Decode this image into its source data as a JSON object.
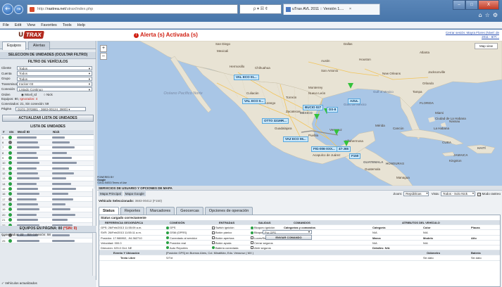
{
  "browser": {
    "url_prefix": "http://",
    "url_host": "rastrea.net",
    "url_rest": "/utrax/index.php",
    "addr_tools": "ρ ▾ ☒ ¢",
    "tab_title": "uTrax AVL 2011 :: Versión 1....",
    "tab_close": "×",
    "menu": [
      "File",
      "Edit",
      "View",
      "Favorites",
      "Tools",
      "Help"
    ],
    "back": "←",
    "forward": "→",
    "min": "–",
    "max": "□",
    "close": "X",
    "tool_icons": [
      "⌂",
      "☆",
      "⚙"
    ]
  },
  "header": {
    "logo_u": "U",
    "logo_trax": "TRAX",
    "alert_icon": "!",
    "alert_text": "Alerta (s) Activada (s)",
    "session_link": "Cerrar sesión: Mayra Flores (Nivel: de",
    "session_sub": "2011 - 8/7/..."
  },
  "left": {
    "tabs": [
      "Equipos",
      "Alertas"
    ],
    "selection_header": "SELECCION DE UNIDADES (OCULTAR FILTRO)",
    "filter_header": "FILTRO DE VEHÍCULOS",
    "filters": [
      {
        "label": "Cliente",
        "value": "Todos"
      },
      {
        "label": "Cuenta",
        "value": "Todos"
      },
      {
        "label": "Grupo",
        "value": "Todos"
      },
      {
        "label": "Transmisor",
        "value": "Iracker-03"
      },
      {
        "label": "Conexión",
        "value": "Listado Continuo"
      }
    ],
    "orden_label": "Orden",
    "orden_opt1": "Movil_Id",
    "orden_opt2": "Nick",
    "equipos_text": "Equipos: 80,",
    "ignorados_text": "Ignorados: 4",
    "conectados_text": "Conectados: 21, Sin conexión: 59",
    "pagina_label": "Página",
    "pagina_value": "01/01 (##3881 - 3683-00124_3900) ▾",
    "update_button": "ACTUALIZAR LISTA DE UNIDADES",
    "list_header": "LISTA DE UNIDADES",
    "list_columns": [
      "#",
      "sts",
      "Movil ID",
      "Nick"
    ],
    "rows": [
      "5",
      "6",
      "7",
      "8",
      "9",
      "10",
      "11",
      "12",
      "13",
      "14",
      "15",
      "16",
      "17",
      "18",
      "19",
      "20",
      "21",
      "22",
      "23",
      "24",
      "25"
    ],
    "row_status": [
      "green",
      "gray",
      "green",
      "green",
      "green",
      "green",
      "green",
      "green",
      "green",
      "green",
      "green",
      "green",
      "gray",
      "green",
      "green",
      "green",
      "green",
      "green",
      "green",
      "gray",
      "green"
    ],
    "eq_pag_header": "EQUIPOS EN PÁGINA: 80",
    "eq_pag_red": "(*SIN: 0)",
    "eq_pag_conn": "Conectados: 22",
    "eq_pag_sin": "Sin conexión: 58",
    "updated": "✓ Vehículos actualizados"
  },
  "map": {
    "type_button": "Map view",
    "zoom_in": "+",
    "zoom_out": "–",
    "ocean_pacific": "Océano Pacífico Norte",
    "footer_google": "Google",
    "footer_text": "POWERED BY",
    "footer_terms": "©2011 INEGI Terms of Use",
    "labels": [
      "San Diego",
      "Dallas",
      "Houston",
      "Mexicali",
      "Hermosillo",
      "Chihuahua",
      "San Antonio",
      "Torreón",
      "Monterrey",
      "Culiacán",
      "Durango",
      "Zacatecas",
      "Guadalajara",
      "MÉXICO",
      "Golfo de México",
      "Mérida",
      "Acapulco de Juárez",
      "Tampa",
      "Miami",
      "Gulf of Mexico",
      "La Habana",
      "CUBA",
      "Ciudad de La Habana",
      "Nassau",
      "GUATEMALA",
      "Guatemala",
      "HONDURAS",
      "Managua",
      "JAMAICA",
      "HAITÍ",
      "Kingston",
      "Cancún",
      "Nuevo León",
      "Villahermosa",
      "Oaxaca",
      "Puebla",
      "Veracruz",
      "Jacksonville",
      "Orlando",
      "FLORIDA",
      "New Orleans",
      "Atlanta",
      "Austin"
    ],
    "vehicles": [
      "VAL ECO 01...",
      "AZUL",
      "BUCIO 027",
      "VAL ECO 0...",
      "OTTO 321MR...",
      "DS-8",
      "VAZ ECO 06...",
      "FIG-006-XXX...",
      "47-J65",
      "F150"
    ]
  },
  "bottom": {
    "svc_header": "SERVICIOS DE USUARIO Y OPCIONES DE MAPA",
    "map_main": "Mapa Principal",
    "map_google": "Mapa Google",
    "zoom_label": "Zoom:",
    "zoom_value": "Repúblicas",
    "vista_label": "Vista:",
    "vista_value": "Todos - Solo Nick",
    "modo_label": "Modo rastreo",
    "veh_sel_label": "Vehículo Seleccionado:",
    "veh_sel_value": "3683-00412 (F150)",
    "tabs": [
      "Status",
      "Reportes",
      "Marcadores",
      "Geocercas",
      "Opciones de operación"
    ],
    "status_loaded": "Status cargado correctamente",
    "headers": [
      "REFERENCIA GEOGRÁFICA",
      "CONEXIÓN",
      "ENTRADAS",
      "SALIDAS",
      "COMANDOS",
      "ATRIBUTOS DEL VEHÍCULO"
    ],
    "rows": [
      {
        "a": "GPS: 26/Feb/2013 11:55:09 a.m.",
        "b": "GPS",
        "c": "Switch ignición",
        "d": "Bloqueo ignición",
        "e": "Categorías y comandos",
        "f": "Categoría",
        "g": "Color",
        "h": "Placas"
      },
      {
        "a": "SVR: 26/Feb/2013 11:55:11 a.m.",
        "b": "GSM (GPRS)",
        "c": "Botón pánico",
        "d": "Bloqueo motor",
        "e": "Por GPS",
        "f": "N/A",
        "g": "N/A",
        "h": ""
      },
      {
        "a": "Posición: 17.988902, -94.362710",
        "b": "Conectado al servidor",
        "c": "Botón apertura",
        "d": "Luces/Sirena",
        "e": "ENVIAR COMANDO",
        "f": "Marca",
        "g": "Modelo",
        "h": "Año"
      },
      {
        "a": "Velocidad: 000.0",
        "b": "Posición real",
        "c": "Botón ayuda",
        "d": "Cerrar seguros",
        "e": "",
        "f": "N/A",
        "g": "N/A",
        "h": ""
      },
      {
        "a": "Dirección: 025.0 Grd. NE",
        "b": "Auto Reportes",
        "c": "Batería conectada",
        "d": "Abrir seguros",
        "e": "",
        "f": "Detalles: N/A",
        "g": "",
        "h": ""
      },
      {
        "a": "Evento Y Ubicación",
        "b": "[Posición GPS] en Buenos Aires, Col. Minatitlán, Edo. Veracruz ( MX )",
        "c": "",
        "d": "",
        "e": "",
        "f": "",
        "g": "Odómetro",
        "h": "Batería"
      },
      {
        "a": "Texto Libre",
        "b": "S/Txt",
        "c": "",
        "d": "",
        "e": "",
        "f": "",
        "g": "Sin dato",
        "h": "Sin dato"
      }
    ]
  },
  "colors": {
    "chrome": "#4877ab",
    "alert": "#d01f12",
    "online": "#29a043",
    "offline": "#6b6b6b",
    "vehicle_label": "#c8e7fb",
    "sea": "#a9c6e6",
    "land": "#e8e3d4"
  },
  "icons": [
    "back-arrow-icon",
    "forward-arrow-icon",
    "home-icon",
    "star-icon",
    "gear-icon",
    "alert-icon",
    "status-dot-icon",
    "vehicle-marker-icon"
  ]
}
